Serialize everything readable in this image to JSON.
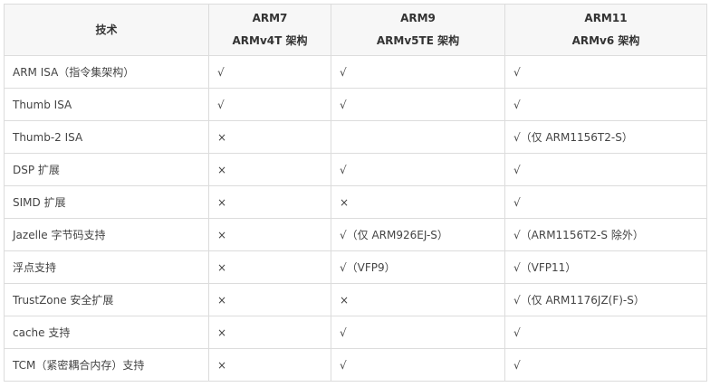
{
  "table": {
    "headers": [
      {
        "line1": "技术",
        "line2": ""
      },
      {
        "line1": "ARM7",
        "line2": "ARMv4T 架构"
      },
      {
        "line1": "ARM9",
        "line2": "ARMv5TE 架构"
      },
      {
        "line1": "ARM11",
        "line2": "ARMv6 架构"
      }
    ],
    "rows": [
      [
        "ARM ISA（指令集架构）",
        "√",
        "√",
        "√"
      ],
      [
        "Thumb ISA",
        "√",
        "√",
        "√"
      ],
      [
        "Thumb-2 ISA",
        "×",
        "",
        "√（仅 ARM1156T2-S）"
      ],
      [
        "DSP 扩展",
        "×",
        "√",
        "√"
      ],
      [
        "SIMD 扩展",
        "×",
        "×",
        "√"
      ],
      [
        "Jazelle 字节码支持",
        "×",
        "√（仅 ARM926EJ-S）",
        "√（ARM1156T2-S 除外）"
      ],
      [
        "浮点支持",
        "×",
        "√（VFP9）",
        "√（VFP11）"
      ],
      [
        "TrustZone 安全扩展",
        "×",
        "×",
        "√（仅 ARM1176JZ(F)-S）"
      ],
      [
        "cache 支持",
        "×",
        "√",
        "√"
      ],
      [
        "TCM（紧密耦合内存）支持",
        "×",
        "√",
        "√"
      ]
    ]
  }
}
